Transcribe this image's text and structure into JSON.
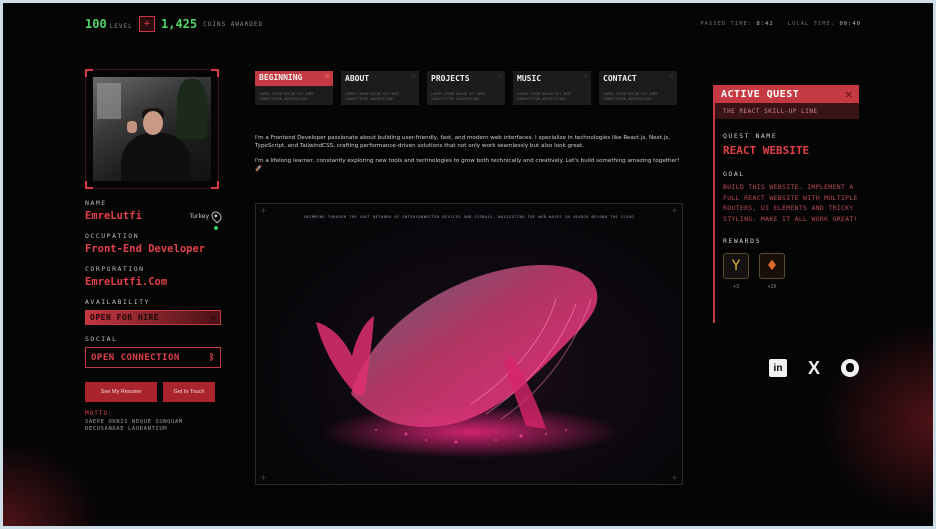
{
  "topbar": {
    "level_num": "100",
    "level_label": "LEVEL",
    "coin_icon": "plus-square-icon",
    "coins_num": "1,425",
    "coins_label": "COINS AWARDED",
    "time1_label": "PASSED TIME:",
    "time1_value": "8:42",
    "time2_label": "LOCAL TIME:",
    "time2_value": "09:40"
  },
  "profile": {
    "name_label": "NAME",
    "name_value": "EmreLutfi",
    "location": "Turkey",
    "occupation_label": "OCCUPATION",
    "occupation_value": "Front-End Developer",
    "corporation_label": "CORPORATION",
    "corporation_value": "EmreLutfi.Com",
    "availability_label": "AVAILABILITY",
    "availability_value": "OPEN FOR HIRE",
    "social_label": "SOCIAL",
    "social_value": "OPEN CONNECTION",
    "btn_resume": "See My Resume",
    "btn_touch": "Get In Touch",
    "motto_label": "MOTTO:",
    "motto_text": "SAEPE ORNIS NEQUE SUNQUAM RECUSANDAE LAUDANTIUM"
  },
  "tabs": [
    {
      "label": "BEGINNING",
      "sub": "LOREM IPSUM DOLOR SIT AMET CONSECTETUR ADIPISICING"
    },
    {
      "label": "ABOUT",
      "sub": "LOREM IPSUM DOLOR SIT AMET CONSECTETUR ADIPISICING"
    },
    {
      "label": "PROJECTS",
      "sub": "LOREM IPSUM DOLOR SIT AMET CONSECTETUR ADIPISICING"
    },
    {
      "label": "MUSIC",
      "sub": "LOREM IPSUM DOLOR SIT AMET CONSECTETUR ADIPISICING"
    },
    {
      "label": "CONTACT",
      "sub": "LOREM IPSUM DOLOR SIT AMET CONSECTETUR ADIPISICING"
    }
  ],
  "intro": {
    "p1": "I'm a Frontend Developer passionate about building user-friendly, fast, and modern web interfaces. I specialize in technologies like React.js, Next.js, TypeScript, and TailwindCSS, crafting performance-driven solutions that not only work seamlessly but also look great.",
    "p2": "I'm a lifelong learner, constantly exploring new tools and technologies to grow both technically and creatively. Let's build something amazing together! 🚀"
  },
  "art": {
    "caption": "SWIMMING THROUGH THE VAST NETWORK OF INTERCONNECTED DEVICES AND SIGNALS, NAVIGATING THE WEB WAVES IN SEARCH BEYOND THE CLOUD"
  },
  "quest": {
    "title": "ACTIVE QUEST",
    "subtitle": "THE REACT SKILL-UP LINE",
    "name_label": "QUEST NAME",
    "name_value": "REACT WEBSITE",
    "goal_label": "GOAL",
    "goal_text": "BUILD THIS WEBSITE. IMPLEMENT A FULL REACT WEBSITE WITH MULTIPLE ROUTERS, UI ELEMENTS AND TRICKY STYLING. MAKE IT ALL WORK GREAT!",
    "rewards_label": "REWARDS",
    "rewards": [
      {
        "icon": "gold-emblem-icon",
        "amount": "+3"
      },
      {
        "icon": "fire-emblem-icon",
        "amount": "+25"
      }
    ]
  },
  "socials": {
    "linkedin": "in",
    "x": "X"
  },
  "colors": {
    "accent": "#c53a42",
    "accent_text": "#e0404a",
    "level_green": "#4fd46a",
    "background": "#050506"
  }
}
